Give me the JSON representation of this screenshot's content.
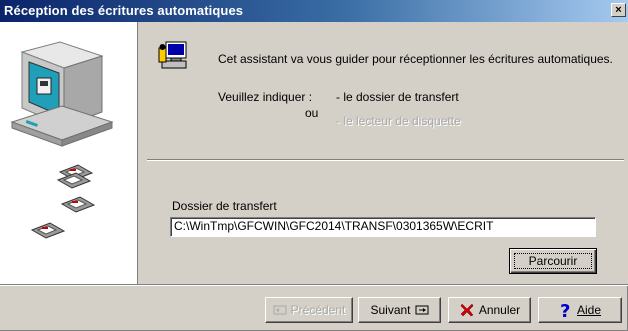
{
  "window": {
    "title": "Réception des écritures automatiques",
    "close_glyph": "×"
  },
  "intro": {
    "icon": "assistant-computer-icon",
    "text": "Cet assistant va vous guider pour réceptionner les écritures automatiques.",
    "indicate_label": "Veuillez indiquer :",
    "option_folder": "- le dossier de transfert",
    "or_label": "ou",
    "option_floppy": "- le lecteur de disquette"
  },
  "transfer": {
    "label": "Dossier de transfert",
    "path_value": "C:\\WinTmp\\GFCWIN\\GFC2014\\TRANSF\\0301365W\\ECRIT",
    "browse_label": "Parcourir"
  },
  "buttons": {
    "previous": "Précédent",
    "next": "Suivant",
    "cancel": "Annuler",
    "help": "Aide"
  },
  "colors": {
    "title_start": "#0a246a",
    "title_end": "#a6caf0",
    "face": "#d4d0c8",
    "cancel_x": "#cc0000",
    "help_q": "#0000cc"
  }
}
